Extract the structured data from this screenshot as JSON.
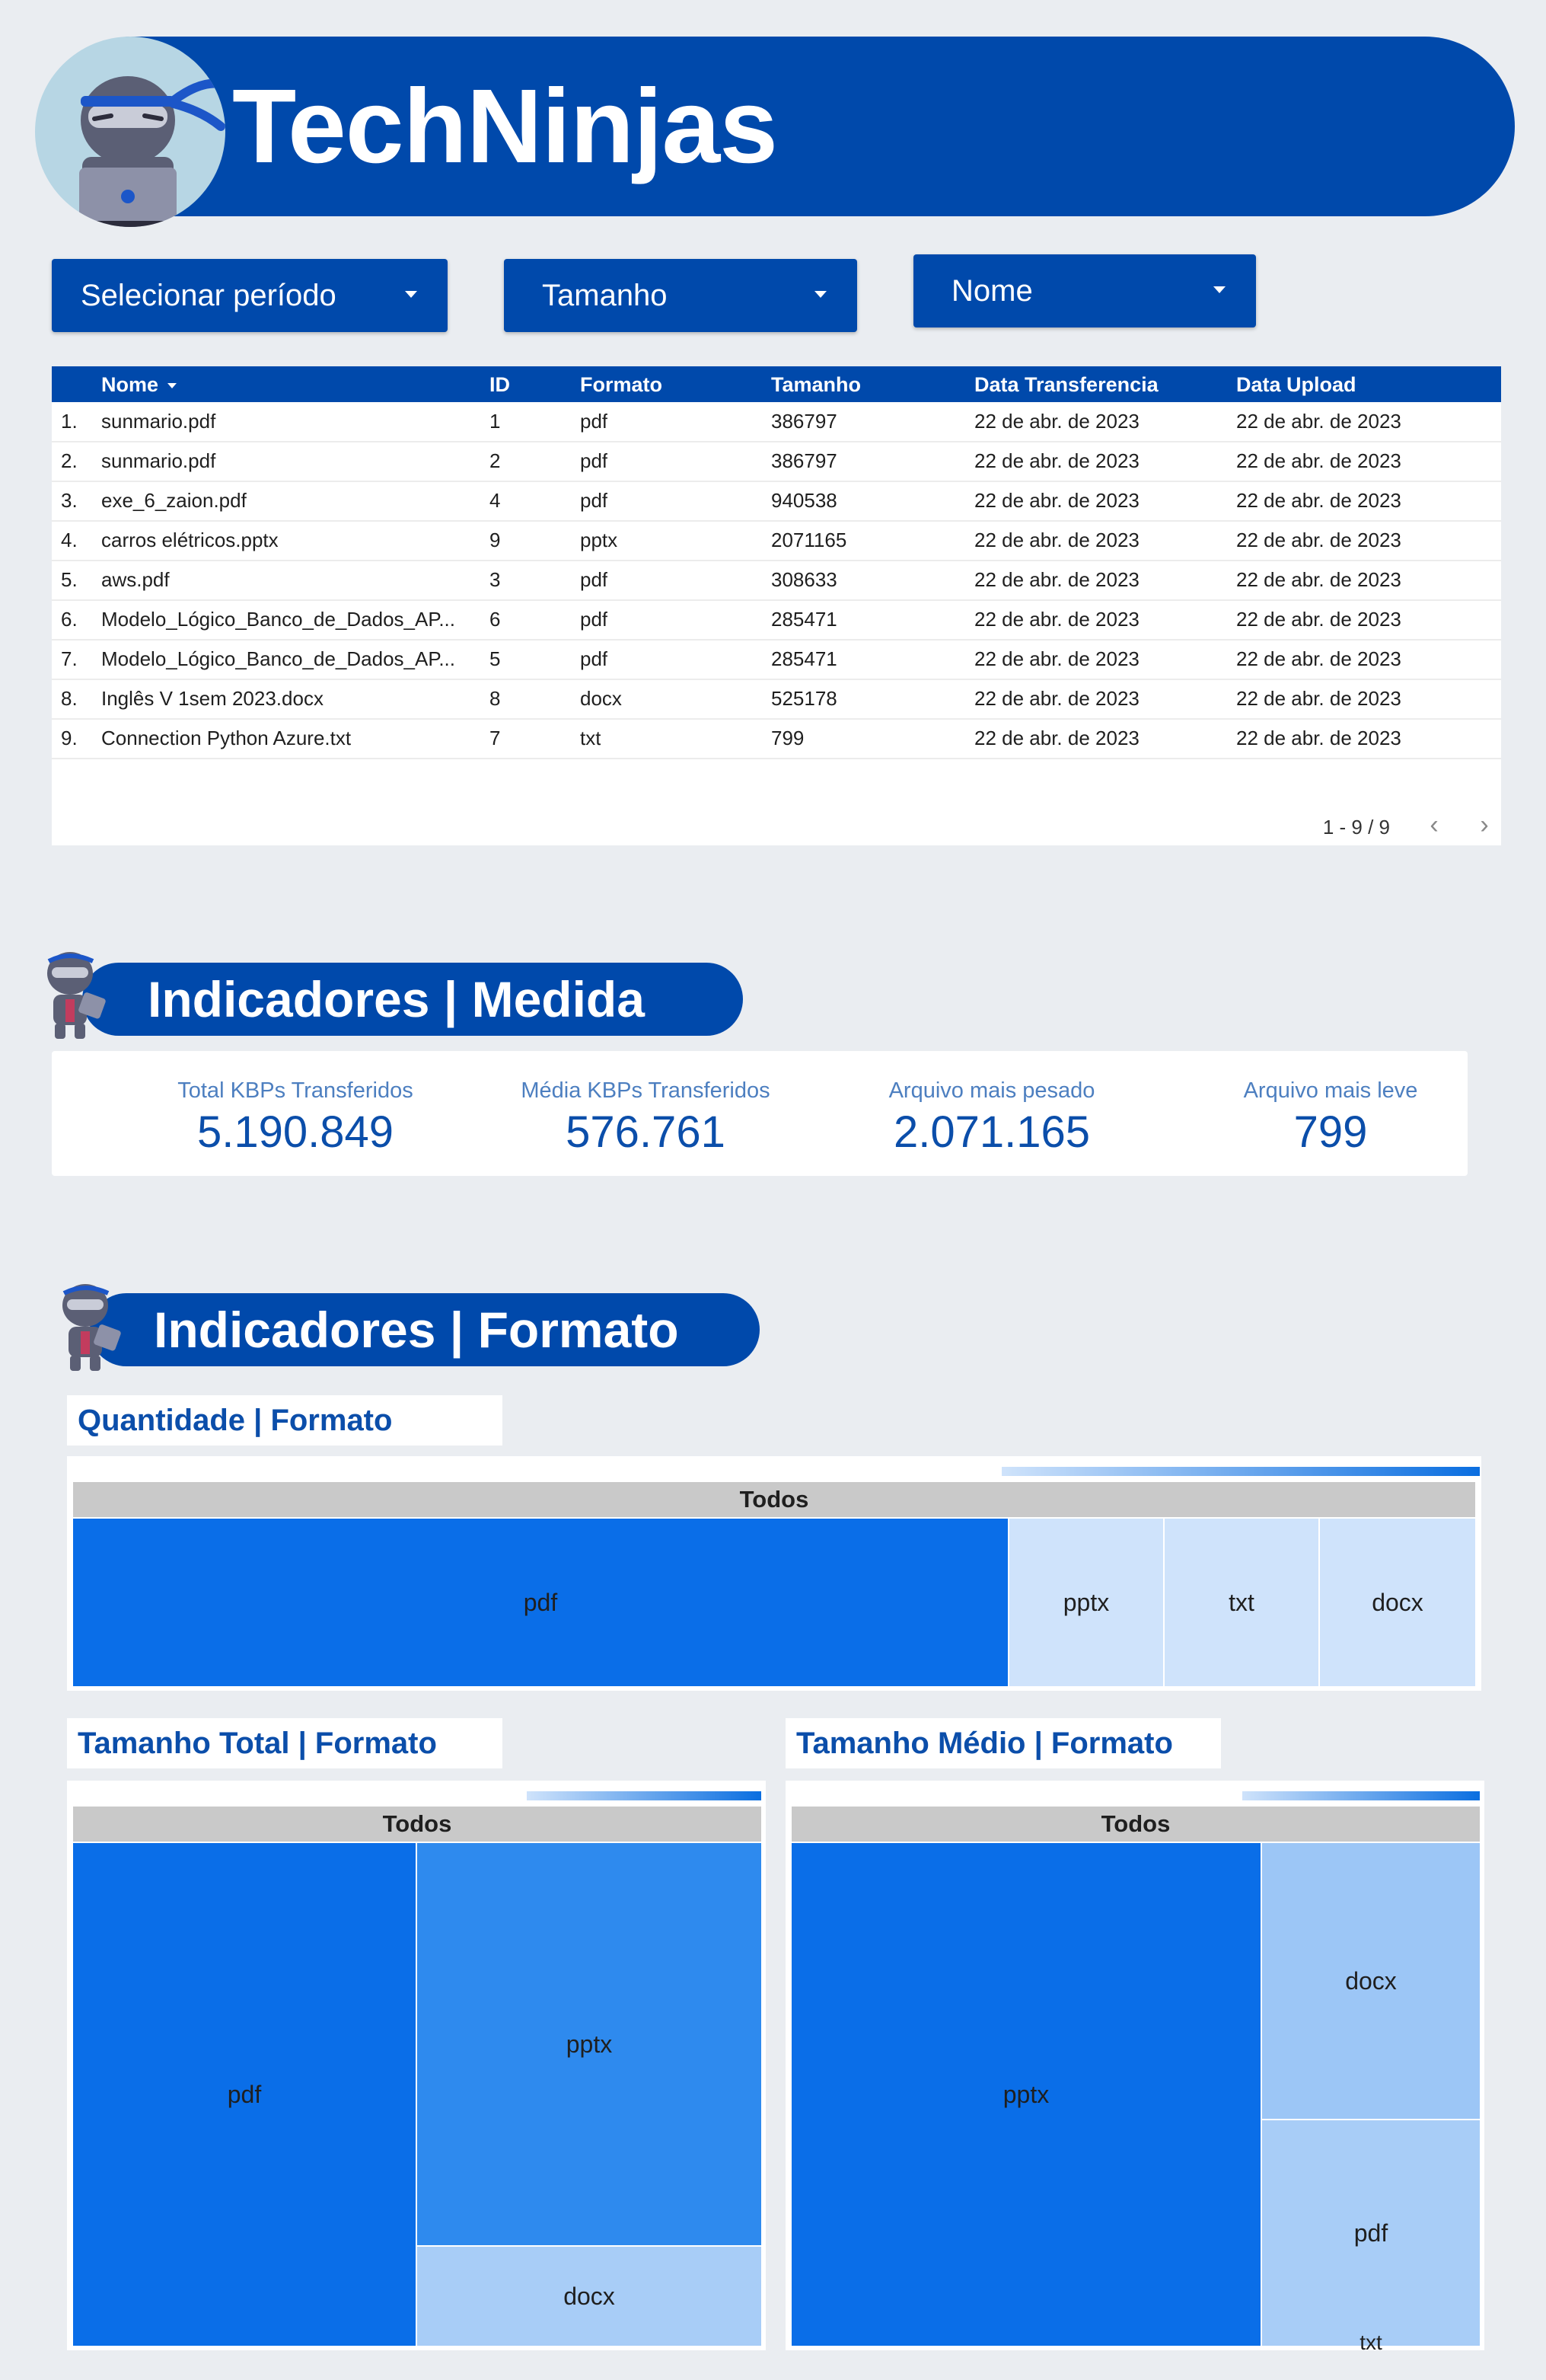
{
  "app": {
    "title": "TechNinjas"
  },
  "filters": {
    "period_label": "Selecionar período",
    "size_label": "Tamanho",
    "name_label": "Nome"
  },
  "table": {
    "columns": [
      "Nome",
      "ID",
      "Formato",
      "Tamanho",
      "Data Transferencia",
      "Data Upload"
    ],
    "rows": [
      {
        "n": "1.",
        "nome": "sunmario.pdf",
        "id": "1",
        "formato": "pdf",
        "tamanho": "386797",
        "dt": "22 de abr. de 2023",
        "du": "22 de abr. de 2023"
      },
      {
        "n": "2.",
        "nome": "sunmario.pdf",
        "id": "2",
        "formato": "pdf",
        "tamanho": "386797",
        "dt": "22 de abr. de 2023",
        "du": "22 de abr. de 2023"
      },
      {
        "n": "3.",
        "nome": "exe_6_zaion.pdf",
        "id": "4",
        "formato": "pdf",
        "tamanho": "940538",
        "dt": "22 de abr. de 2023",
        "du": "22 de abr. de 2023"
      },
      {
        "n": "4.",
        "nome": "carros elétricos.pptx",
        "id": "9",
        "formato": "pptx",
        "tamanho": "2071165",
        "dt": "22 de abr. de 2023",
        "du": "22 de abr. de 2023"
      },
      {
        "n": "5.",
        "nome": "aws.pdf",
        "id": "3",
        "formato": "pdf",
        "tamanho": "308633",
        "dt": "22 de abr. de 2023",
        "du": "22 de abr. de 2023"
      },
      {
        "n": "6.",
        "nome": "Modelo_Lógico_Banco_de_Dados_AP...",
        "id": "6",
        "formato": "pdf",
        "tamanho": "285471",
        "dt": "22 de abr. de 2023",
        "du": "22 de abr. de 2023"
      },
      {
        "n": "7.",
        "nome": "Modelo_Lógico_Banco_de_Dados_AP...",
        "id": "5",
        "formato": "pdf",
        "tamanho": "285471",
        "dt": "22 de abr. de 2023",
        "du": "22 de abr. de 2023"
      },
      {
        "n": "8.",
        "nome": "Inglês V 1sem 2023.docx",
        "id": "8",
        "formato": "docx",
        "tamanho": "525178",
        "dt": "22 de abr. de 2023",
        "du": "22 de abr. de 2023"
      },
      {
        "n": "9.",
        "nome": "Connection Python Azure.txt",
        "id": "7",
        "formato": "txt",
        "tamanho": "799",
        "dt": "22 de abr. de 2023",
        "du": "22 de abr. de 2023"
      }
    ],
    "pagination": "1 - 9 / 9"
  },
  "section_medida": {
    "title": "Indicadores | Medida"
  },
  "kpis": [
    {
      "label": "Total KBPs Transferidos",
      "value": "5.190.849"
    },
    {
      "label": "Média KBPs Transferidos",
      "value": "576.761"
    },
    {
      "label": "Arquivo mais pesado",
      "value": "2.071.165"
    },
    {
      "label": "Arquivo mais leve",
      "value": "799"
    }
  ],
  "section_formato": {
    "title": "Indicadores | Formato"
  },
  "charts": {
    "quantidade": {
      "title": "Quantidade | Formato",
      "root": "Todos",
      "cells": [
        {
          "label": "pdf",
          "color": "#0a6ee8"
        },
        {
          "label": "pptx",
          "color": "#cfe3fb"
        },
        {
          "label": "txt",
          "color": "#cfe3fb"
        },
        {
          "label": "docx",
          "color": "#cfe3fb"
        }
      ]
    },
    "tamanho_total": {
      "title": "Tamanho Total | Formato",
      "root": "Todos",
      "cells": [
        {
          "label": "pdf",
          "color": "#0a6ee8"
        },
        {
          "label": "pptx",
          "color": "#2e8aee"
        },
        {
          "label": "docx",
          "color": "#a8cdf7"
        }
      ]
    },
    "tamanho_medio": {
      "title": "Tamanho Médio | Formato",
      "root": "Todos",
      "cells": [
        {
          "label": "pptx",
          "color": "#0a6ee8"
        },
        {
          "label": "docx",
          "color": "#9cc6f6"
        },
        {
          "label": "pdf",
          "color": "#a8cdf7"
        },
        {
          "label": "txt",
          "color": "#a8cdf7"
        }
      ]
    }
  },
  "icons": {
    "sort": "sort-down-icon",
    "prev": "chevron-left-icon",
    "next": "chevron-right-icon",
    "dropdown": "caret-down-icon"
  }
}
